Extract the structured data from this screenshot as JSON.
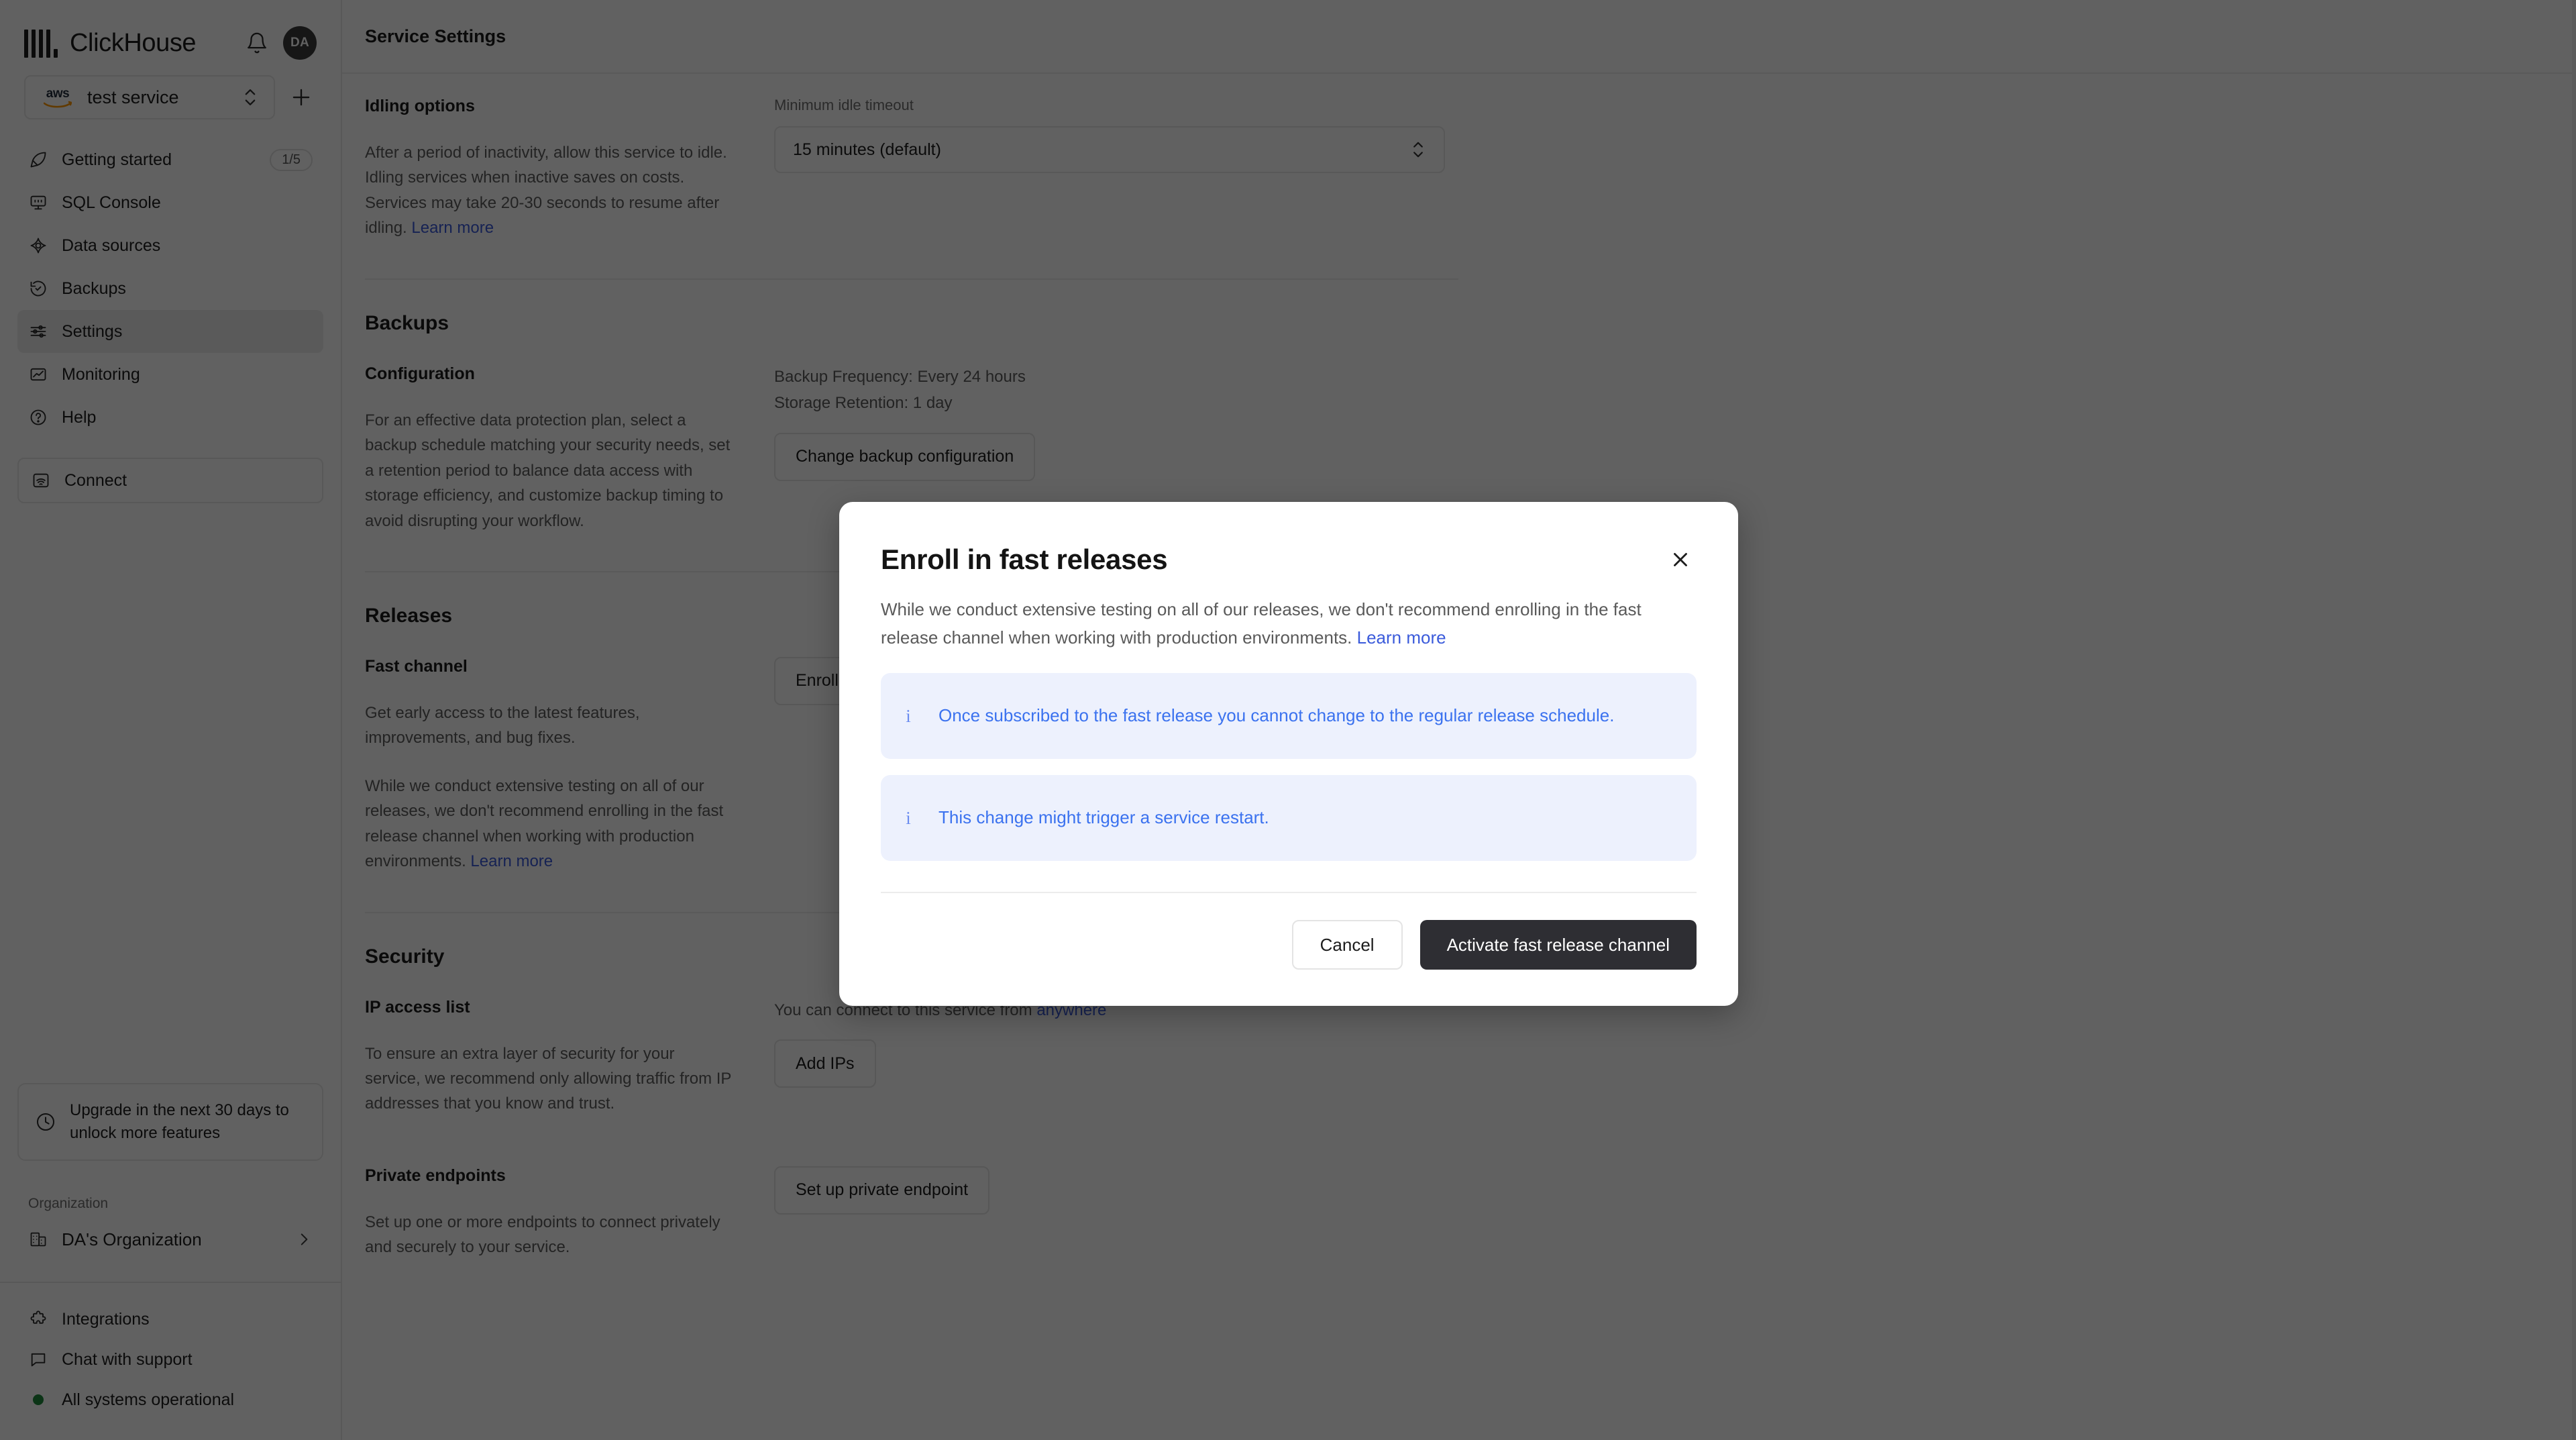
{
  "brand": {
    "name": "ClickHouse",
    "avatar_initials": "DA"
  },
  "service_selector": {
    "provider": "aws",
    "service_name": "test service",
    "add_label": "+"
  },
  "sidebar": {
    "items": [
      {
        "label": "Getting started",
        "icon": "rocket-icon",
        "badge": "1/5",
        "active": false
      },
      {
        "label": "SQL Console",
        "icon": "console-icon",
        "badge": "",
        "active": false
      },
      {
        "label": "Data sources",
        "icon": "data-sources-icon",
        "badge": "",
        "active": false
      },
      {
        "label": "Backups",
        "icon": "history-icon",
        "badge": "",
        "active": false
      },
      {
        "label": "Settings",
        "icon": "sliders-icon",
        "badge": "",
        "active": true
      },
      {
        "label": "Monitoring",
        "icon": "chart-image-icon",
        "badge": "",
        "active": false
      },
      {
        "label": "Help",
        "icon": "question-circle-icon",
        "badge": "",
        "active": false
      }
    ],
    "connect_label": "Connect",
    "upgrade_banner": "Upgrade in the next 30 days to unlock more features",
    "org_section_label": "Organization",
    "org_name": "DA's Organization",
    "footer_items": [
      {
        "label": "Integrations",
        "icon": "puzzle-icon"
      },
      {
        "label": "Chat with support",
        "icon": "chat-bubble-icon"
      },
      {
        "label": "All systems operational",
        "icon": "status-dot-icon"
      }
    ]
  },
  "main": {
    "header_title": "Service Settings",
    "idling": {
      "title": "Idling options",
      "description": "After a period of inactivity, allow this service to idle. Idling services when inactive saves on costs. Services may take 20-30 seconds to resume after idling. ",
      "link": "Learn more",
      "field_label": "Minimum idle timeout",
      "field_value": "15 minutes (default)"
    },
    "backups": {
      "section": "Backups",
      "title": "Configuration",
      "description": "For an effective data protection plan, select a backup schedule matching your security needs, set a retention period to balance data access with storage efficiency, and customize backup timing to avoid disrupting your workflow.",
      "frequency": "Backup Frequency: Every 24 hours",
      "retention": "Storage Retention: 1 day",
      "button": "Change backup configuration"
    },
    "releases": {
      "section": "Releases",
      "title": "Fast channel",
      "paragraph1": "Get early access to the latest features, improvements, and bug fixes.",
      "paragraph2": "While we conduct extensive testing on all of our releases, we don't recommend enrolling in the fast release channel when working with production environments. ",
      "link": "Learn more",
      "button": "Enroll in fast releases"
    },
    "security": {
      "section": "Security",
      "ip": {
        "title": "IP access list",
        "description": "To ensure an extra layer of security for your service, we recommend only allowing traffic from IP addresses that you know and trust.",
        "status_prefix": "You can connect to this service from ",
        "status_link": "anywhere",
        "button": "Add IPs"
      },
      "endpoints": {
        "title": "Private endpoints",
        "description": "Set up one or more endpoints to connect privately and securely to your service.",
        "button": "Set up private endpoint"
      }
    }
  },
  "modal": {
    "title": "Enroll in fast releases",
    "description": "While we conduct extensive testing on all of our releases, we don't recommend enrolling in the fast release channel when working with production environments. ",
    "description_link": "Learn more",
    "alerts": [
      {
        "icon": "info-icon",
        "text": "Once subscribed to the fast release you cannot change to the regular release schedule."
      },
      {
        "icon": "info-icon",
        "text": "This change might trigger a service restart."
      }
    ],
    "cancel_label": "Cancel",
    "confirm_label": "Activate fast release channel",
    "close_icon": "close-icon"
  },
  "colors": {
    "accent_link": "#3b5bdb",
    "alert_bg": "#edf1fd",
    "alert_text": "#3b72ef",
    "primary_button_bg": "#2e2e33",
    "status_ok": "#1e8a3c"
  }
}
